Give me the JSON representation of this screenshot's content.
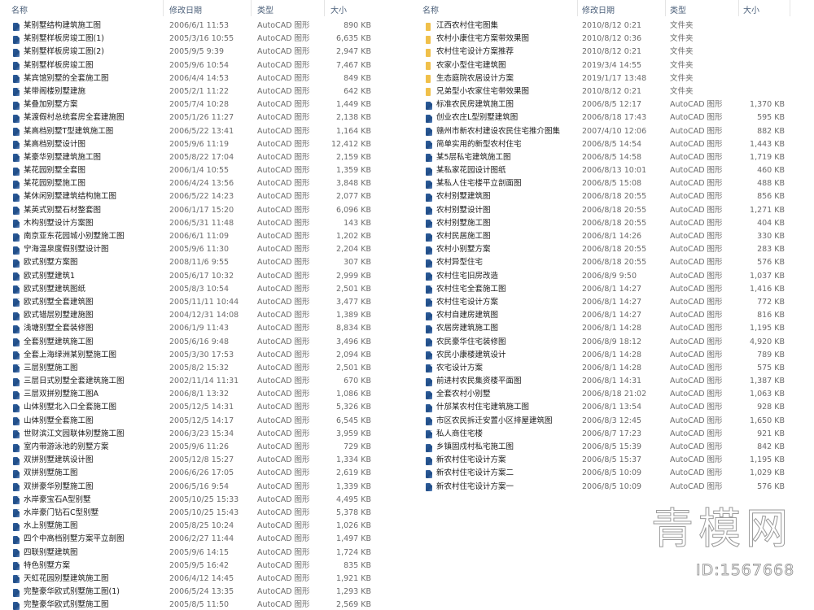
{
  "columns": {
    "name": "名称",
    "date": "修改日期",
    "type": "类型",
    "size": "大小"
  },
  "colors": {
    "dwg_icon": "#1f4c86",
    "folder_icon": "#f0c04a",
    "header_text": "#4c607a"
  },
  "left_files": [
    {
      "name": "某别墅结构建筑施工图",
      "date": "2006/6/1 11:53",
      "type": "AutoCAD 图形",
      "size": "890 KB",
      "icon": "dwg-file-icon"
    },
    {
      "name": "某别墅样板房竣工图(1)",
      "date": "2005/3/16 10:55",
      "type": "AutoCAD 图形",
      "size": "6,635 KB",
      "icon": "dwg-file-icon"
    },
    {
      "name": "某别墅样板房竣工图(2)",
      "date": "2005/9/5 9:39",
      "type": "AutoCAD 图形",
      "size": "2,947 KB",
      "icon": "dwg-file-icon"
    },
    {
      "name": "某别墅样板房竣工图",
      "date": "2005/9/6 10:54",
      "type": "AutoCAD 图形",
      "size": "7,467 KB",
      "icon": "dwg-file-icon"
    },
    {
      "name": "某宾馆别墅的全套施工图",
      "date": "2006/4/4 14:53",
      "type": "AutoCAD 图形",
      "size": "849 KB",
      "icon": "dwg-file-icon"
    },
    {
      "name": "某带阁楼别墅建施",
      "date": "2005/2/1 11:22",
      "type": "AutoCAD 图形",
      "size": "642 KB",
      "icon": "dwg-file-icon"
    },
    {
      "name": "某叠加别墅方案",
      "date": "2005/7/4 10:28",
      "type": "AutoCAD 图形",
      "size": "1,449 KB",
      "icon": "dwg-file-icon"
    },
    {
      "name": "某渡假村总统套房全套建施图",
      "date": "2005/1/26 11:27",
      "type": "AutoCAD 图形",
      "size": "2,138 KB",
      "icon": "dwg-file-icon"
    },
    {
      "name": "某高档别墅T型建筑施工图",
      "date": "2006/5/22 13:41",
      "type": "AutoCAD 图形",
      "size": "1,164 KB",
      "icon": "dwg-file-icon"
    },
    {
      "name": "某高档别墅设计图",
      "date": "2005/9/6 11:19",
      "type": "AutoCAD 图形",
      "size": "12,412 KB",
      "icon": "dwg-file-icon"
    },
    {
      "name": "某豪华别墅建筑施工图",
      "date": "2005/8/22 17:04",
      "type": "AutoCAD 图形",
      "size": "2,159 KB",
      "icon": "dwg-file-icon"
    },
    {
      "name": "某花园别墅全套图",
      "date": "2006/1/4 10:55",
      "type": "AutoCAD 图形",
      "size": "1,359 KB",
      "icon": "dwg-file-icon"
    },
    {
      "name": "某花园别墅施工图",
      "date": "2006/4/24 13:56",
      "type": "AutoCAD 图形",
      "size": "3,848 KB",
      "icon": "dwg-file-icon"
    },
    {
      "name": "某休闲别墅建筑结构施工图",
      "date": "2006/5/22 14:23",
      "type": "AutoCAD 图形",
      "size": "2,077 KB",
      "icon": "dwg-file-icon"
    },
    {
      "name": "某英式别墅石材整套图",
      "date": "2006/1/17 15:20",
      "type": "AutoCAD 图形",
      "size": "6,096 KB",
      "icon": "dwg-file-icon"
    },
    {
      "name": "木构别墅设计方案图",
      "date": "2006/5/31 11:48",
      "type": "AutoCAD 图形",
      "size": "143 KB",
      "icon": "dwg-file-icon"
    },
    {
      "name": "南京亚东花园城小别墅施工图",
      "date": "2006/6/1 11:09",
      "type": "AutoCAD 图形",
      "size": "1,202 KB",
      "icon": "dwg-file-icon"
    },
    {
      "name": "宁海温泉度假别墅设计图",
      "date": "2005/9/6 11:30",
      "type": "AutoCAD 图形",
      "size": "2,204 KB",
      "icon": "dwg-file-icon"
    },
    {
      "name": "欧式别墅方案图",
      "date": "2008/11/6 9:55",
      "type": "AutoCAD 图形",
      "size": "307 KB",
      "icon": "dwg-file-icon"
    },
    {
      "name": "欧式别墅建筑1",
      "date": "2005/6/17 10:32",
      "type": "AutoCAD 图形",
      "size": "2,999 KB",
      "icon": "dwg-file-icon"
    },
    {
      "name": "欧式别墅建筑图纸",
      "date": "2005/8/3 10:54",
      "type": "AutoCAD 图形",
      "size": "2,501 KB",
      "icon": "dwg-file-icon"
    },
    {
      "name": "欧式别墅全套建筑图",
      "date": "2005/11/11 10:44",
      "type": "AutoCAD 图形",
      "size": "3,477 KB",
      "icon": "dwg-file-icon"
    },
    {
      "name": "欧式错层别墅建施图",
      "date": "2004/12/31 14:08",
      "type": "AutoCAD 图形",
      "size": "1,389 KB",
      "icon": "dwg-file-icon"
    },
    {
      "name": "浅塘别墅全套装修图",
      "date": "2006/1/9 11:43",
      "type": "AutoCAD 图形",
      "size": "8,834 KB",
      "icon": "dwg-file-icon"
    },
    {
      "name": "全套别墅建筑施工图",
      "date": "2005/6/16 9:48",
      "type": "AutoCAD 图形",
      "size": "3,496 KB",
      "icon": "dwg-file-icon"
    },
    {
      "name": "全套上海绿洲某别墅施工图",
      "date": "2005/3/30 17:53",
      "type": "AutoCAD 图形",
      "size": "2,094 KB",
      "icon": "dwg-file-icon"
    },
    {
      "name": "三层别墅施工图",
      "date": "2005/8/2 15:32",
      "type": "AutoCAD 图形",
      "size": "2,501 KB",
      "icon": "dwg-file-icon"
    },
    {
      "name": "三层日式别墅全套建筑施工图",
      "date": "2002/11/14 11:31",
      "type": "AutoCAD 图形",
      "size": "670 KB",
      "icon": "dwg-file-icon"
    },
    {
      "name": "三层双拼别墅施工图A",
      "date": "2006/8/1 13:32",
      "type": "AutoCAD 图形",
      "size": "1,086 KB",
      "icon": "dwg-file-icon"
    },
    {
      "name": "山体别墅北入口全套施工图",
      "date": "2005/12/5 14:31",
      "type": "AutoCAD 图形",
      "size": "5,326 KB",
      "icon": "dwg-file-icon"
    },
    {
      "name": "山体别墅全套施工图",
      "date": "2005/12/5 14:17",
      "type": "AutoCAD 图形",
      "size": "6,545 KB",
      "icon": "dwg-file-icon"
    },
    {
      "name": "世财滨江文园联体别墅施工图",
      "date": "2006/3/23 15:34",
      "type": "AutoCAD 图形",
      "size": "3,959 KB",
      "icon": "dwg-file-icon"
    },
    {
      "name": "室内带游泳池的别墅方案",
      "date": "2005/9/6 11:26",
      "type": "AutoCAD 图形",
      "size": "729 KB",
      "icon": "dwg-file-icon"
    },
    {
      "name": "双拼别墅建筑设计图",
      "date": "2005/12/8 15:27",
      "type": "AutoCAD 图形",
      "size": "1,334 KB",
      "icon": "dwg-file-icon"
    },
    {
      "name": "双拼别墅施工图",
      "date": "2006/6/26 17:05",
      "type": "AutoCAD 图形",
      "size": "2,619 KB",
      "icon": "dwg-file-icon"
    },
    {
      "name": "双拼豪华别墅施工图",
      "date": "2006/5/16 9:54",
      "type": "AutoCAD 图形",
      "size": "1,339 KB",
      "icon": "dwg-file-icon"
    },
    {
      "name": "水岸豪宝石A型别墅",
      "date": "2005/10/25 15:33",
      "type": "AutoCAD 图形",
      "size": "4,495 KB",
      "icon": "dwg-file-icon"
    },
    {
      "name": "水岸豪门钻石C型别墅",
      "date": "2005/10/25 15:43",
      "type": "AutoCAD 图形",
      "size": "5,378 KB",
      "icon": "dwg-file-icon"
    },
    {
      "name": "水上别墅施工图",
      "date": "2005/8/25 10:24",
      "type": "AutoCAD 图形",
      "size": "1,026 KB",
      "icon": "dwg-file-icon"
    },
    {
      "name": "四个中高档别墅方案平立剖图",
      "date": "2006/2/27 11:44",
      "type": "AutoCAD 图形",
      "size": "1,497 KB",
      "icon": "dwg-file-icon"
    },
    {
      "name": "四联别墅建筑图",
      "date": "2005/9/6 14:15",
      "type": "AutoCAD 图形",
      "size": "1,724 KB",
      "icon": "dwg-file-icon"
    },
    {
      "name": "特色别墅方案",
      "date": "2005/9/5 16:42",
      "type": "AutoCAD 图形",
      "size": "835 KB",
      "icon": "dwg-file-icon"
    },
    {
      "name": "天虹花园别墅建筑施工图",
      "date": "2006/4/12 14:45",
      "type": "AutoCAD 图形",
      "size": "1,921 KB",
      "icon": "dwg-file-icon"
    },
    {
      "name": "完整豪华欧式别墅施工图(1)",
      "date": "2006/5/24 13:35",
      "type": "AutoCAD 图形",
      "size": "1,293 KB",
      "icon": "dwg-file-icon"
    },
    {
      "name": "完整豪华欧式别墅施工图",
      "date": "2005/8/5 11:50",
      "type": "AutoCAD 图形",
      "size": "2,569 KB",
      "icon": "dwg-file-icon"
    }
  ],
  "right_files": [
    {
      "name": "江西农村住宅图集",
      "date": "2010/8/12 0:21",
      "type": "文件夹",
      "size": "",
      "icon": "folder-icon"
    },
    {
      "name": "农村小康住宅方案带效果图",
      "date": "2010/8/12 0:36",
      "type": "文件夹",
      "size": "",
      "icon": "folder-icon"
    },
    {
      "name": "农村住宅设计方案推荐",
      "date": "2010/8/12 0:21",
      "type": "文件夹",
      "size": "",
      "icon": "folder-icon"
    },
    {
      "name": "农家小型住宅建筑图",
      "date": "2019/3/4 14:55",
      "type": "文件夹",
      "size": "",
      "icon": "folder-icon"
    },
    {
      "name": "生态庭院农居设计方案",
      "date": "2019/1/17 13:48",
      "type": "文件夹",
      "size": "",
      "icon": "folder-icon"
    },
    {
      "name": "兄弟型小农家住宅带效果图",
      "date": "2010/8/12 0:21",
      "type": "文件夹",
      "size": "",
      "icon": "folder-icon"
    },
    {
      "name": "标准农民房建筑施工图",
      "date": "2006/8/5 12:17",
      "type": "AutoCAD 图形",
      "size": "1,370 KB",
      "icon": "dwg-file-icon"
    },
    {
      "name": "创业农庄L型别墅建筑图",
      "date": "2006/8/18 17:43",
      "type": "AutoCAD 图形",
      "size": "595 KB",
      "icon": "dwg-file-icon"
    },
    {
      "name": "赣州市新农村建设农民住宅推介图集",
      "date": "2007/4/10 12:06",
      "type": "AutoCAD 图形",
      "size": "882 KB",
      "icon": "dwg-file-icon"
    },
    {
      "name": "简单实用的新型农村住宅",
      "date": "2006/8/5 14:54",
      "type": "AutoCAD 图形",
      "size": "1,443 KB",
      "icon": "dwg-file-icon"
    },
    {
      "name": "某5层私宅建筑施工图",
      "date": "2006/8/5 14:58",
      "type": "AutoCAD 图形",
      "size": "1,719 KB",
      "icon": "dwg-file-icon"
    },
    {
      "name": "某私家花园设计图纸",
      "date": "2006/8/13 10:01",
      "type": "AutoCAD 图形",
      "size": "460 KB",
      "icon": "dwg-file-icon"
    },
    {
      "name": "某私人住宅楼平立剖面图",
      "date": "2006/8/5 15:08",
      "type": "AutoCAD 图形",
      "size": "488 KB",
      "icon": "dwg-file-icon"
    },
    {
      "name": "农村别墅建筑图",
      "date": "2006/8/18 20:55",
      "type": "AutoCAD 图形",
      "size": "856 KB",
      "icon": "dwg-file-icon"
    },
    {
      "name": "农村别墅设计图",
      "date": "2006/8/18 20:55",
      "type": "AutoCAD 图形",
      "size": "1,271 KB",
      "icon": "dwg-file-icon"
    },
    {
      "name": "农村别墅施工图",
      "date": "2006/8/18 20:55",
      "type": "AutoCAD 图形",
      "size": "404 KB",
      "icon": "dwg-file-icon"
    },
    {
      "name": "农村民居施工图",
      "date": "2006/8/1 14:26",
      "type": "AutoCAD 图形",
      "size": "330 KB",
      "icon": "dwg-file-icon"
    },
    {
      "name": "农村小别墅方案",
      "date": "2006/8/18 20:55",
      "type": "AutoCAD 图形",
      "size": "283 KB",
      "icon": "dwg-file-icon"
    },
    {
      "name": "农村异型住宅",
      "date": "2006/8/18 20:55",
      "type": "AutoCAD 图形",
      "size": "576 KB",
      "icon": "dwg-file-icon"
    },
    {
      "name": "农村住宅旧房改造",
      "date": "2006/8/9 9:50",
      "type": "AutoCAD 图形",
      "size": "1,037 KB",
      "icon": "dwg-file-icon"
    },
    {
      "name": "农村住宅全套施工图",
      "date": "2006/8/1 14:27",
      "type": "AutoCAD 图形",
      "size": "1,416 KB",
      "icon": "dwg-file-icon"
    },
    {
      "name": "农村住宅设计方案",
      "date": "2006/8/1 14:27",
      "type": "AutoCAD 图形",
      "size": "772 KB",
      "icon": "dwg-file-icon"
    },
    {
      "name": "农村自建房建筑图",
      "date": "2006/8/1 14:27",
      "type": "AutoCAD 图形",
      "size": "816 KB",
      "icon": "dwg-file-icon"
    },
    {
      "name": "农居房建筑施工图",
      "date": "2006/8/1 14:28",
      "type": "AutoCAD 图形",
      "size": "1,195 KB",
      "icon": "dwg-file-icon"
    },
    {
      "name": "农民豪华住宅装修图",
      "date": "2006/8/9 18:12",
      "type": "AutoCAD 图形",
      "size": "4,920 KB",
      "icon": "dwg-file-icon"
    },
    {
      "name": "农民小康楼建筑设计",
      "date": "2006/8/1 14:28",
      "type": "AutoCAD 图形",
      "size": "789 KB",
      "icon": "dwg-file-icon"
    },
    {
      "name": "农宅设计方案",
      "date": "2006/8/1 14:28",
      "type": "AutoCAD 图形",
      "size": "575 KB",
      "icon": "dwg-file-icon"
    },
    {
      "name": "前进村农民集资楼平面图",
      "date": "2006/8/1 14:31",
      "type": "AutoCAD 图形",
      "size": "1,387 KB",
      "icon": "dwg-file-icon"
    },
    {
      "name": "全套农村小别墅",
      "date": "2006/8/18 21:02",
      "type": "AutoCAD 图形",
      "size": "1,063 KB",
      "icon": "dwg-file-icon"
    },
    {
      "name": "什邡某农村住宅建筑施工图",
      "date": "2006/8/1 13:54",
      "type": "AutoCAD 图形",
      "size": "928 KB",
      "icon": "dwg-file-icon"
    },
    {
      "name": "市区农民拆迁安置小区排屋建筑图",
      "date": "2006/8/3 12:45",
      "type": "AutoCAD 图形",
      "size": "1,650 KB",
      "icon": "dwg-file-icon"
    },
    {
      "name": "私人商住宅楼",
      "date": "2006/8/7 17:23",
      "type": "AutoCAD 图形",
      "size": "921 KB",
      "icon": "dwg-file-icon"
    },
    {
      "name": "乡镇固戍村私宅施工图",
      "date": "2006/8/5 15:39",
      "type": "AutoCAD 图形",
      "size": "842 KB",
      "icon": "dwg-file-icon"
    },
    {
      "name": "新农村住宅设计方案",
      "date": "2006/8/5 15:37",
      "type": "AutoCAD 图形",
      "size": "1,195 KB",
      "icon": "dwg-file-icon"
    },
    {
      "name": "新农村住宅设计方案二",
      "date": "2006/8/5 10:09",
      "type": "AutoCAD 图形",
      "size": "1,029 KB",
      "icon": "dwg-file-icon"
    },
    {
      "name": "新农村住宅设计方案一",
      "date": "2006/8/5 10:09",
      "type": "AutoCAD 图形",
      "size": "576 KB",
      "icon": "dwg-file-icon"
    }
  ],
  "watermark": {
    "logo": "青模网",
    "id": "ID:1567668"
  }
}
